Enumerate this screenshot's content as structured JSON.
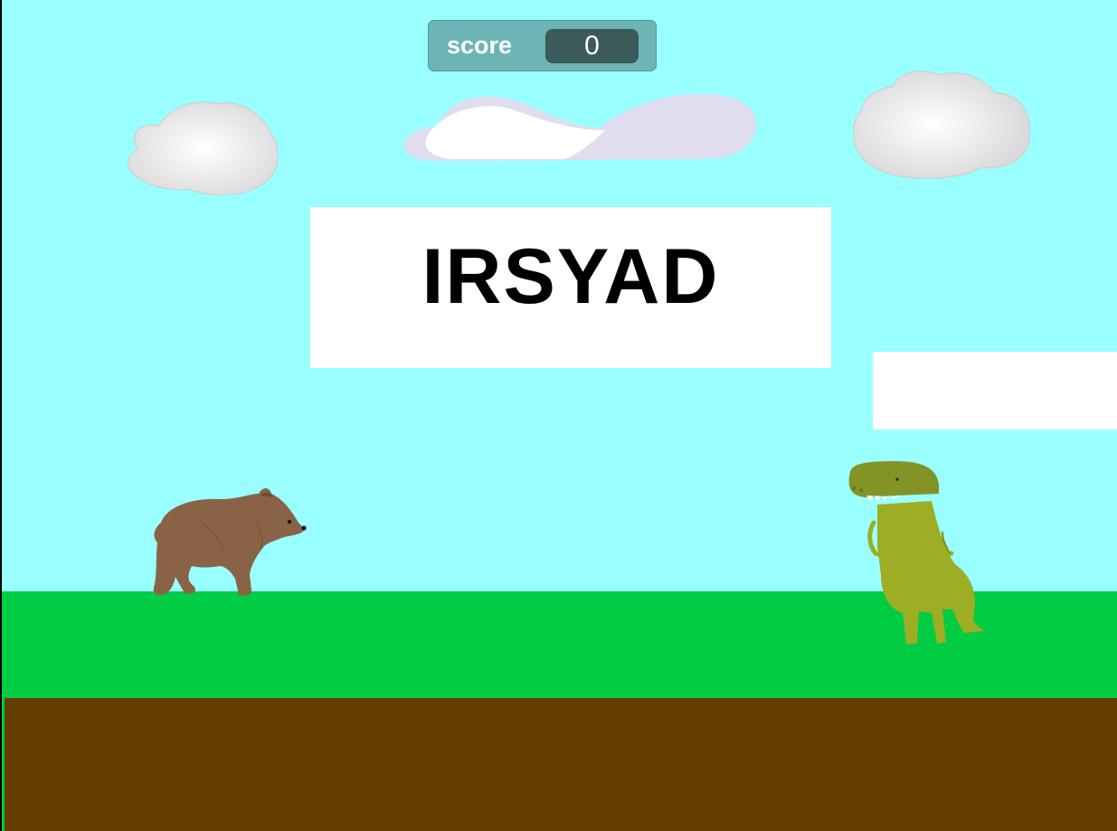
{
  "score_monitor": {
    "label": "score",
    "value": "0"
  },
  "title_sign": {
    "text": "IRSYAD"
  },
  "colors": {
    "sky": "#99ffff",
    "grass": "#00cc44",
    "dirt": "#663d00",
    "monitor_bg": "#6db5b5",
    "monitor_value_bg": "#3b5a5a"
  },
  "sprites": {
    "clouds": [
      "cloud-icon",
      "cloud-icon",
      "cloud-icon"
    ],
    "bear": "bear-icon",
    "dinosaur": "dinosaur-icon"
  }
}
